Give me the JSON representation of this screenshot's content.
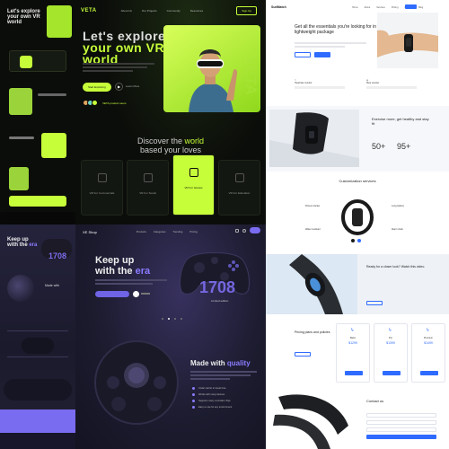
{
  "vr": {
    "logo": "VETA",
    "nav": [
      "About Us",
      "Our Projects",
      "Community",
      "Resources"
    ],
    "signup": "Sign Up",
    "hero_title_1": "Let's explore",
    "hero_title_2": "your own VR",
    "hero_title_3": "world",
    "cta": "Start Exploring",
    "play_label": "Learn More",
    "users_label": "VETA product users",
    "vertical_text": "VETA",
    "discover_1": "Discover the ",
    "discover_hl": "world",
    "discover_2": "based your loves",
    "categories": [
      "VR For Commercials",
      "VR For Social",
      "VR For Games",
      "VR For Education"
    ],
    "active_category": "VR For Games",
    "accent": "#c6ff3a"
  },
  "xe": {
    "logo": "XE Shop",
    "nav": [
      "Products",
      "Categories",
      "Trending",
      "Pricing"
    ],
    "title_1": "Keep up",
    "title_2": "with the ",
    "title_hl": "era",
    "price": "1708",
    "price_label": "Limited edition",
    "quality_1": "Made with ",
    "quality_hl": "quality",
    "features": [
      "Under carrier in travel time",
      "Works with many devices",
      "Supports many controller chips",
      "Easy to use for any environment"
    ],
    "accent": "#7d6ef0"
  },
  "fit": {
    "logo": "SuitMatch",
    "nav": [
      "Home",
      "About",
      "Services",
      "Pricing",
      "Contact",
      "Blog"
    ],
    "hero_title": "Get all the essentials you're looking for in a lightweight package",
    "features": [
      "Heartrate monitor",
      "Step counter"
    ],
    "device_title": "Exercise more, get healthy and stay fit",
    "stats": [
      "50+",
      "95+"
    ],
    "services_title": "Customization services",
    "services": [
      "Fitness tracker",
      "Long battery",
      "Water resistant",
      "Alarm clock"
    ],
    "ready_title": "Ready for a closer look? Watch this video.",
    "pricing_title": "Pricing plans and policies",
    "plans": [
      {
        "name": "Basic",
        "price": "$1299"
      },
      {
        "name": "Pro",
        "price": "$1399"
      },
      {
        "name": "Premium",
        "price": "$1499"
      }
    ],
    "contact_title": "Contact us",
    "accent": "#2f6bff"
  }
}
